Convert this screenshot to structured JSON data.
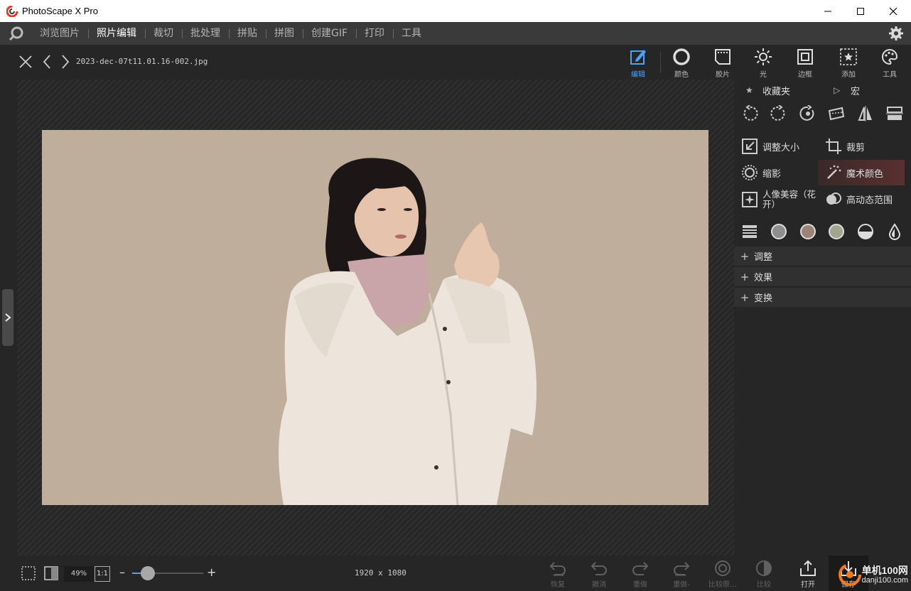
{
  "window": {
    "title": "PhotoScape X Pro"
  },
  "menu": {
    "items": [
      {
        "label": "浏览图片",
        "active": false
      },
      {
        "label": "照片编辑",
        "active": true
      },
      {
        "label": "裁切",
        "active": false
      },
      {
        "label": "批处理",
        "active": false
      },
      {
        "label": "拼贴",
        "active": false
      },
      {
        "label": "拼图",
        "active": false
      },
      {
        "label": "创建GIF",
        "active": false
      },
      {
        "label": "打印",
        "active": false
      },
      {
        "label": "工具",
        "active": false
      }
    ]
  },
  "toolbar": {
    "filename": "2023-dec-07t11.01.16-002.jpg",
    "tabs": [
      {
        "label": "编辑",
        "icon": "edit-icon",
        "active": true
      },
      {
        "label": "颜色",
        "icon": "color-icon"
      },
      {
        "label": "胶片",
        "icon": "film-icon"
      },
      {
        "label": "光",
        "icon": "light-icon"
      },
      {
        "label": "边框",
        "icon": "frame-icon"
      },
      {
        "label": "添加",
        "icon": "insert-icon"
      },
      {
        "label": "工具",
        "icon": "tools-icon"
      }
    ]
  },
  "panel": {
    "favorites_label": "收藏夹",
    "macro_label": "宏",
    "features": {
      "resize": "调整大小",
      "crop": "裁剪",
      "vignette": "缩影",
      "magic_color": "魔术颜色",
      "beauty": "人像美容（花开）",
      "hdr": "高动态范围"
    },
    "sections": [
      "调整",
      "效果",
      "变换"
    ]
  },
  "status": {
    "zoom": "49%",
    "one_to_one": "1:1",
    "zoom_level": 0.22,
    "dimensions": "1920 x 1080",
    "actions": [
      "恢复",
      "撤消",
      "重做",
      "重做-",
      "比较原…",
      "比较"
    ],
    "open_label": "打开",
    "save_label": "保存",
    "watermark": "单机100网",
    "watermark_sub": "danji100.com"
  },
  "colors": {
    "accent": "#4aa3ff",
    "photo_bg": "#bfae9c"
  }
}
